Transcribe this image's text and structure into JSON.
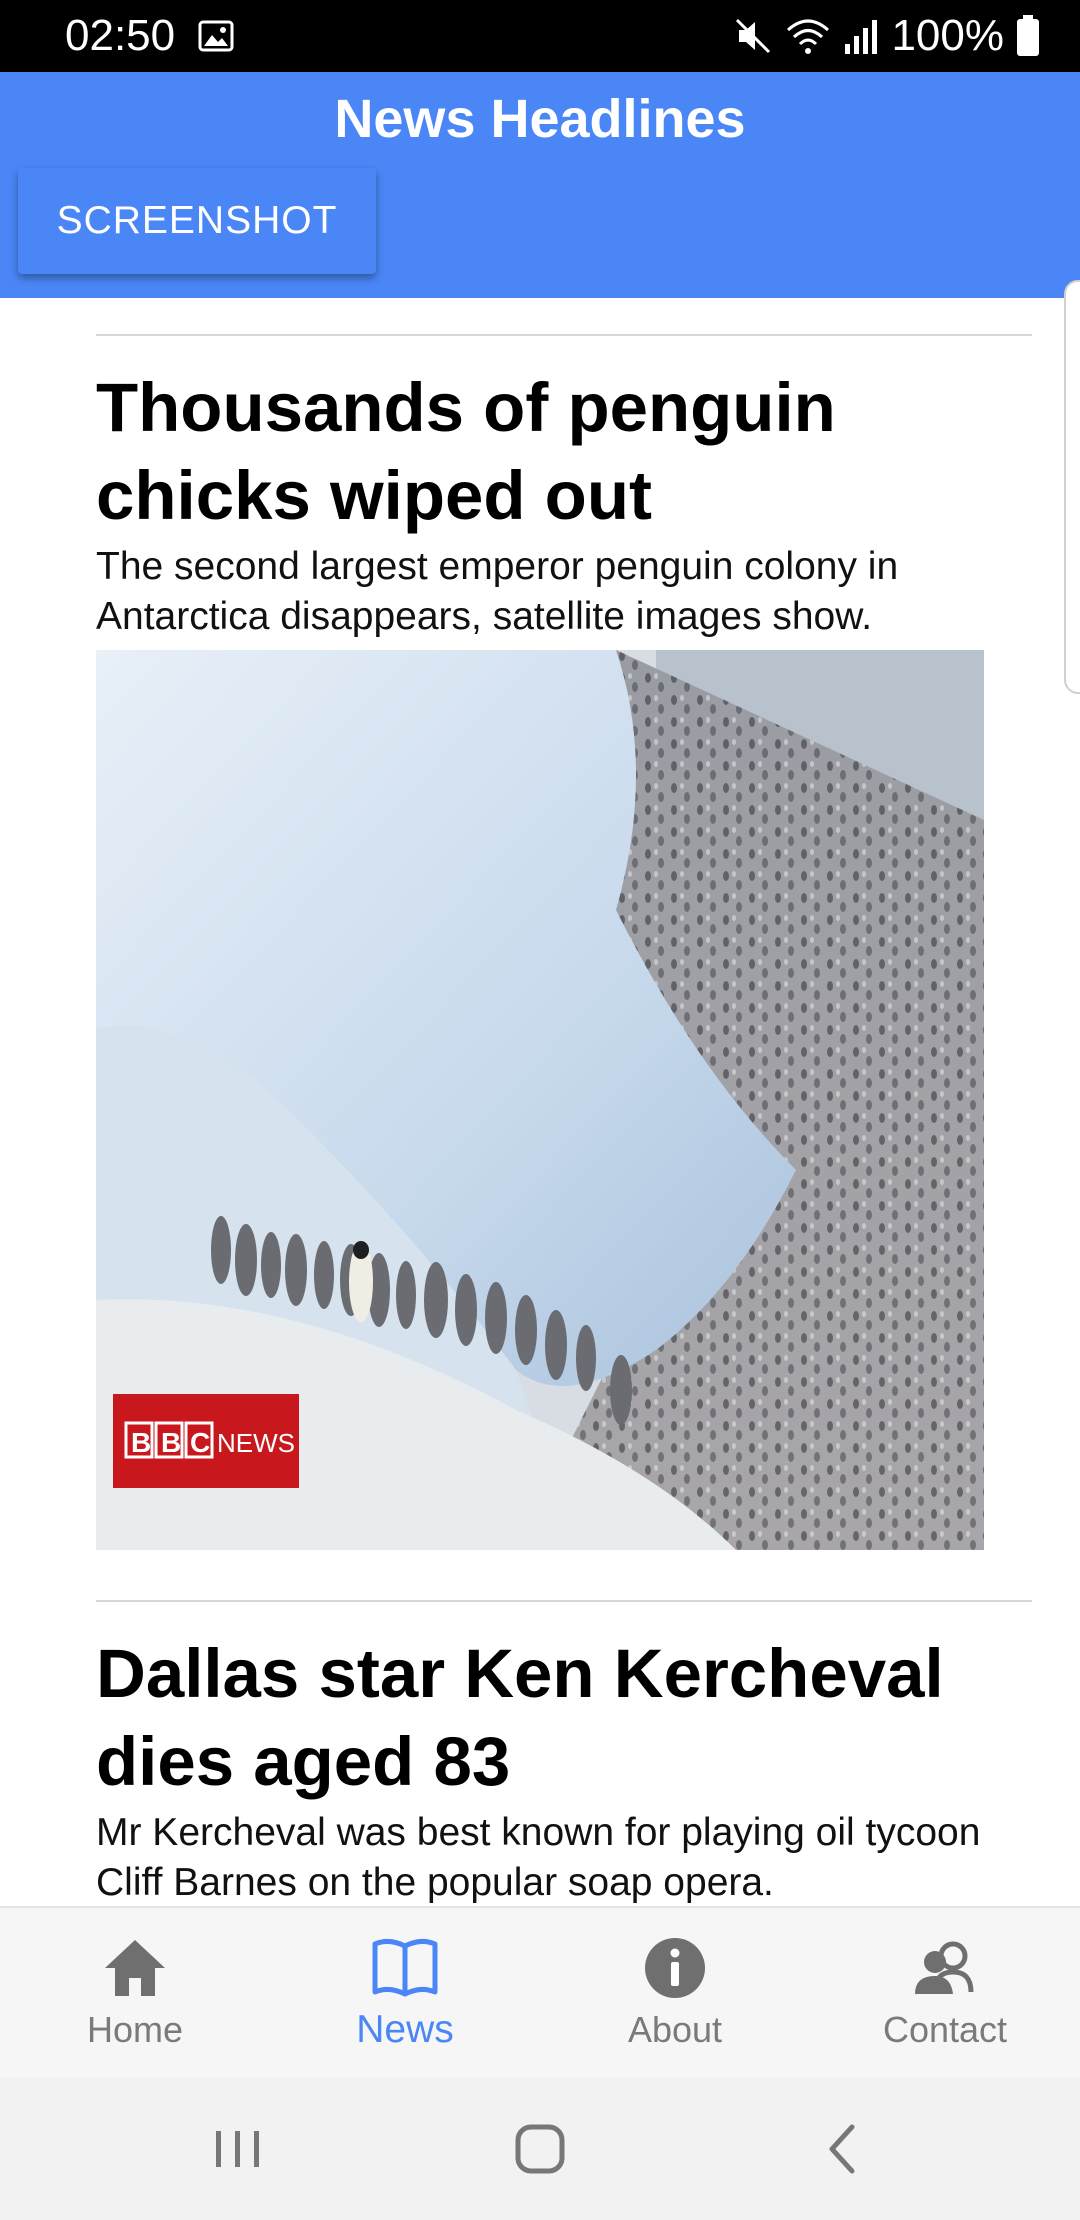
{
  "status_bar": {
    "time": "02:50",
    "battery": "100%",
    "icons": [
      "gallery-icon",
      "mute-icon",
      "wifi-icon",
      "signal-icon",
      "battery-icon"
    ]
  },
  "header": {
    "title": "News Headlines",
    "screenshot_button": "SCREENSHOT",
    "color": "#4a86f5"
  },
  "articles": [
    {
      "title": "Thousands of penguin chicks wiped out",
      "summary": "The second largest emperor penguin colony in Antarctica disappears, satellite images show.",
      "image_logo_text": "BBC NEWS"
    },
    {
      "title": "Dallas star Ken Kercheval dies aged 83",
      "summary": "Mr Kercheval was best known for playing oil tycoon Cliff Barnes on the popular soap opera."
    }
  ],
  "bottom_nav": {
    "active": "News",
    "active_color": "#4a86f5",
    "items": [
      {
        "label": "Home",
        "icon": "home-icon"
      },
      {
        "label": "News",
        "icon": "book-icon"
      },
      {
        "label": "About",
        "icon": "info-icon"
      },
      {
        "label": "Contact",
        "icon": "contacts-icon"
      }
    ]
  },
  "system_nav": {
    "icons": [
      "recents-icon",
      "home-button-icon",
      "back-icon"
    ]
  }
}
